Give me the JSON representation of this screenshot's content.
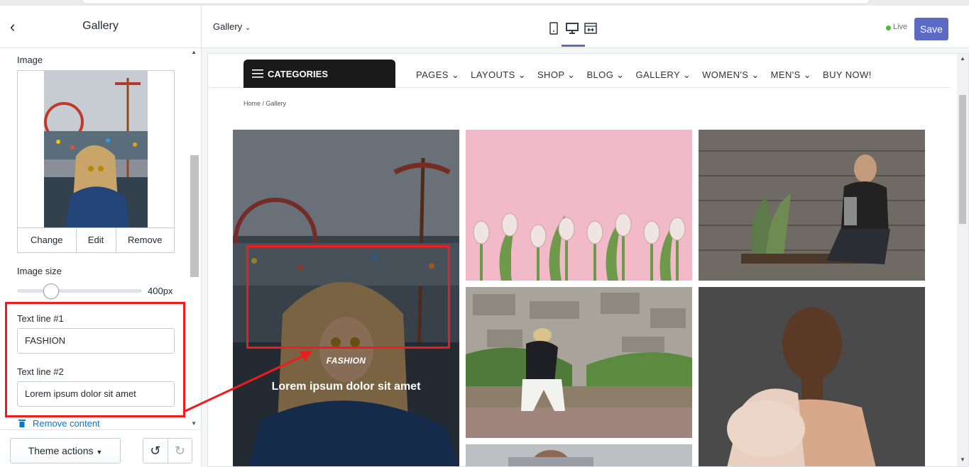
{
  "sidebar": {
    "title": "Gallery",
    "image_label": "Image",
    "image_actions": {
      "change": "Change",
      "edit": "Edit",
      "remove": "Remove"
    },
    "image_size_label": "Image size",
    "image_size_value": "400px",
    "image_size_fraction": 0.27,
    "text_line_1_label": "Text line #1",
    "text_line_1_value": "FASHION",
    "text_line_2_label": "Text line #2",
    "text_line_2_value": "Lorem ipsum dolor sit amet",
    "remove_content": "Remove content",
    "theme_actions": "Theme actions"
  },
  "topbar": {
    "page_selector": "Gallery",
    "live_label": "Live",
    "save_label": "Save",
    "devices": [
      "mobile-icon",
      "desktop-icon",
      "fullwidth-icon"
    ],
    "active_device": "desktop-icon"
  },
  "store": {
    "categories_label": "CATEGORIES",
    "menu": [
      "PAGES",
      "LAYOUTS",
      "SHOP",
      "BLOG",
      "GALLERY",
      "WOMEN'S",
      "MEN'S",
      "BUY NOW!"
    ],
    "breadcrumb": "Home  /  Gallery",
    "featured_caption_line1": "FASHION",
    "featured_caption_line2": "Lorem ipsum dolor sit amet"
  },
  "colors": {
    "accent": "#5c6ac4",
    "live": "#50b83c",
    "highlight": "#ee1c1c",
    "link": "#007ace"
  }
}
